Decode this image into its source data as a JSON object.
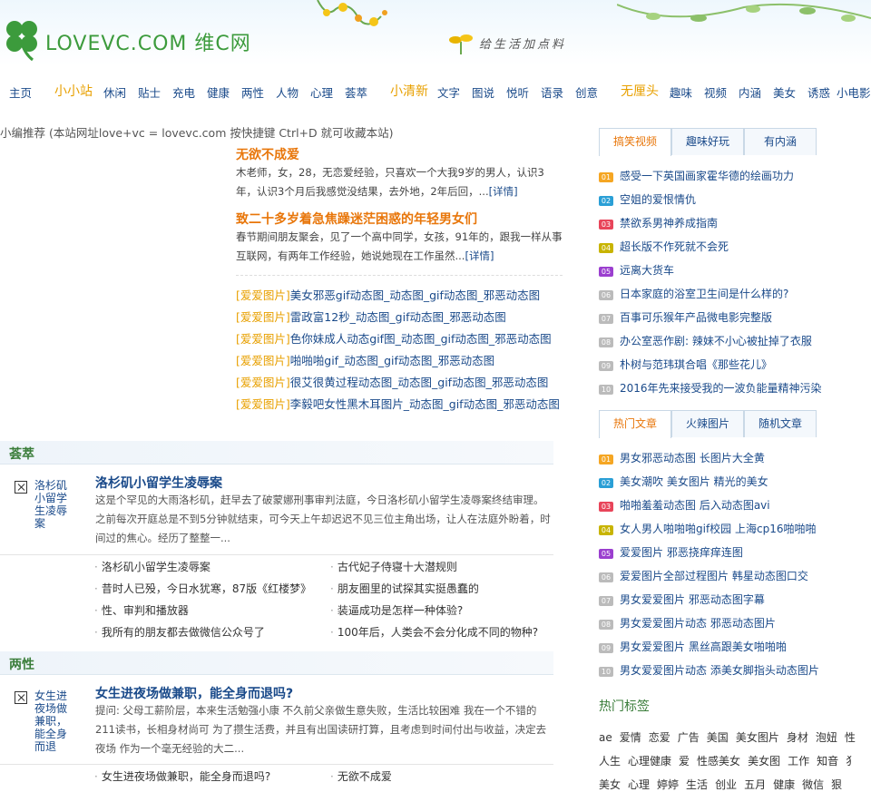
{
  "site": {
    "logo_text": "LOVEVC.COM 维C网",
    "slogan": "给生活加点料"
  },
  "nav": [
    {
      "label": "主页",
      "group": false
    },
    {
      "label": "小小站",
      "group": true
    },
    {
      "label": "休闲",
      "group": false
    },
    {
      "label": "贴士",
      "group": false
    },
    {
      "label": "充电",
      "group": false
    },
    {
      "label": "健康",
      "group": false
    },
    {
      "label": "两性",
      "group": false
    },
    {
      "label": "人物",
      "group": false
    },
    {
      "label": "心理",
      "group": false
    },
    {
      "label": "荟萃",
      "group": false
    },
    {
      "label": "小清新",
      "group": true
    },
    {
      "label": "文字",
      "group": false
    },
    {
      "label": "图说",
      "group": false
    },
    {
      "label": "悦听",
      "group": false
    },
    {
      "label": "语录",
      "group": false
    },
    {
      "label": "创意",
      "group": false
    },
    {
      "label": "无厘头",
      "group": true
    },
    {
      "label": "趣味",
      "group": false
    },
    {
      "label": "视频",
      "group": false
    },
    {
      "label": "内涵",
      "group": false
    },
    {
      "label": "美女",
      "group": false
    },
    {
      "label": "诱惑",
      "group": false
    },
    {
      "label": "小电影",
      "group": false
    }
  ],
  "recommend": {
    "bar": "小编推荐 (本站网址love+vc = lovevc.com 按快捷键 Ctrl+D 就可收藏本站)",
    "features": [
      {
        "title": "无欲不成爱",
        "text": "木老师，女，28，无恋爱经验，只喜欢一个大我9岁的男人，认识3年，认识3个月后我感觉没结果，去外地，2年后回，...",
        "more": "[详情]"
      },
      {
        "title": "致二十多岁着急焦躁迷茫困惑的年轻男女们",
        "text": "春节期间朋友聚会，见了一个高中同学，女孩，91年的，跟我一样从事互联网，有两年工作经验，她说她现在工作虽然...",
        "more": "[详情]"
      }
    ],
    "pics": [
      {
        "tag": "[爱爱图片]",
        "title": "美女邪恶gif动态图_动态图_gif动态图_邪恶动态图"
      },
      {
        "tag": "[爱爱图片]",
        "title": "雷政富12秒_动态图_gif动态图_邪恶动态图"
      },
      {
        "tag": "[爱爱图片]",
        "title": "色你妹成人动态gif图_动态图_gif动态图_邪恶动态图"
      },
      {
        "tag": "[爱爱图片]",
        "title": "啪啪啪gif_动态图_gif动态图_邪恶动态图"
      },
      {
        "tag": "[爱爱图片]",
        "title": "很艾很黄过程动态图_动态图_gif动态图_邪恶动态图"
      },
      {
        "tag": "[爱爱图片]",
        "title": "李毅吧女性黑木耳图片_动态图_gif动态图_邪恶动态图"
      }
    ]
  },
  "sections": [
    {
      "heading": "荟萃",
      "thumb_alt": "洛杉矶小留学生凌辱案",
      "title": "洛杉矶小留学生凌辱案",
      "text": "这是个罕见的大雨洛杉矶，赶早去了破蒙娜刑事审判法庭，今日洛杉矶小留学生凌辱案终结审理。之前每次开庭总是不到5分钟就结束，可今天上午却迟迟不见三位主角出场，让人在法庭外盼着，时间过的焦心。经历了整整一...",
      "links": [
        "洛杉矶小留学生凌辱案",
        "古代妃子侍寝十大潜规则",
        "昔时人已殁，今日水犹寒，87版《红楼梦》",
        "朋友圈里的试探其实挺愚蠢的",
        "性、审判和播放器",
        "装逼成功是怎样一种体验?",
        "我所有的朋友都去做微信公众号了",
        "100年后，人类会不会分化成不同的物种?"
      ]
    },
    {
      "heading": "两性",
      "thumb_alt": "女生进夜场做兼职，能全身而退吗?",
      "title": "女生进夜场做兼职，能全身而退吗?",
      "text": "提问: 父母工薪阶层，本来生活勉强小康 不久前父亲做生意失败，生活比较困难 我在一个不错的211读书，长相身材尚可 为了攒生活费，并且有出国读研打算，且考虑到时间付出与收益，决定去夜场 作为一个毫无经验的大二...",
      "links": [
        "女生进夜场做兼职，能全身而退吗?",
        "无欲不成爱"
      ]
    }
  ],
  "right": {
    "tabs1": [
      "搞笑视频",
      "趣味好玩",
      "有内涵"
    ],
    "list1": [
      "感受一下英国画家霍华德的绘画功力",
      "空姐的爱恨情仇",
      "禁欲系男神养成指南",
      "超长版不作死就不会死",
      "远离大货车",
      "日本家庭的浴室卫生间是什么样的?",
      "百事可乐猴年产品微电影完整版",
      "办公室恶作剧: 辣妹不小心被扯掉了衣服",
      "朴树与范玮琪合唱《那些花儿》",
      "2016年先来接受我的一波负能量精神污染"
    ],
    "tabs2": [
      "热门文章",
      "火辣图片",
      "随机文章"
    ],
    "list2": [
      "男女邪恶动态图 长图片大全黄",
      "美女潮吹 美女图片 精光的美女",
      "啪啪羞羞动态图 后入动态图avi",
      "女人男人啪啪啪gif校园 上海cp16啪啪啪",
      "爱爱图片 邪恶挠痒痒连图",
      "爱爱图片全部过程图片 韩星动态图口交",
      "男女爱爱图片 邪恶动态图字幕",
      "男女爱爱图片动态 邪恶动态图片",
      "男女爱爱图片 黑丝高跟美女啪啪啪",
      "男女爱爱图片动态 添美女脚指头动态图片"
    ],
    "num_labels": [
      "01",
      "02",
      "03",
      "04",
      "05",
      "06",
      "07",
      "08",
      "09",
      "10"
    ],
    "num_colors": [
      "#f5a623",
      "#2a9fd6",
      "#e8455a",
      "#c8b400",
      "#9b3fcf",
      "#bbbbbb",
      "#bbbbbb",
      "#bbbbbb",
      "#bbbbbb",
      "#bbbbbb"
    ],
    "hot_title": "热门标签",
    "tags": [
      [
        "ae",
        "爱情",
        "恋爱",
        "广告",
        "美国",
        "美女图片",
        "身材",
        "泡妞",
        "性"
      ],
      [
        "人生",
        "心理健康",
        "爱",
        "性感美女",
        "美女图",
        "工作",
        "知音",
        "犭"
      ],
      [
        "美女",
        "心理",
        "婷婷",
        "生活",
        "创业",
        "五月",
        "健康",
        "微信",
        "狠"
      ]
    ]
  }
}
